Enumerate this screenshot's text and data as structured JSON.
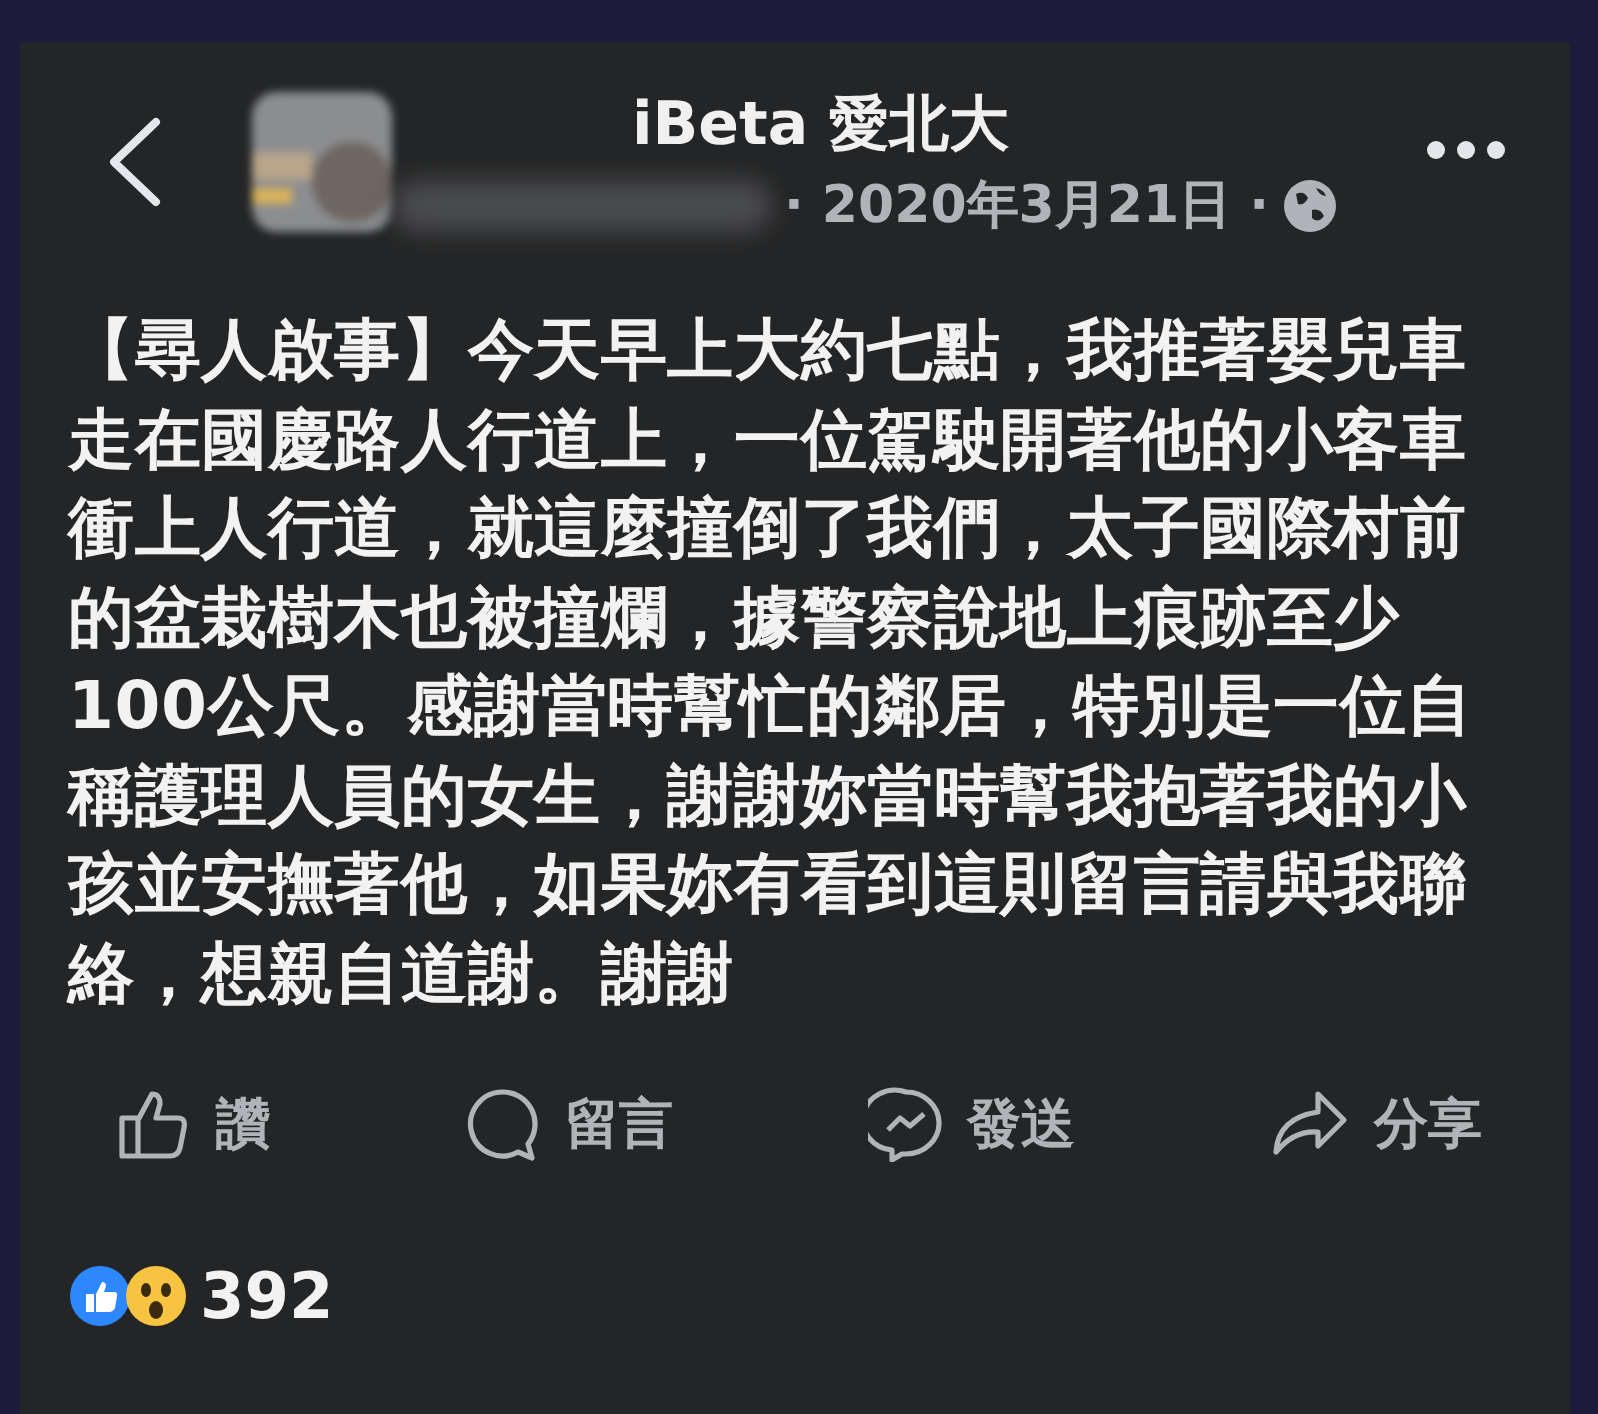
{
  "post": {
    "author": "iBeta 愛北大",
    "date": "· 2020年3月21日 ·",
    "text": "【尋人啟事】今天早上大約七點，我推著嬰兒車走在國慶路人行道上，一位駕駛開著他的小客車衝上人行道，就這麼撞倒了我們，太子國際村前的盆栽樹木也被撞爛，據警察說地上痕跡至少100公尺。感謝當時幫忙的鄰居，特別是一位自稱護理人員的女生，謝謝妳當時幫我抱著我的小孩並安撫著他，如果妳有看到這則留言請與我聯絡，想親自道謝。謝謝"
  },
  "actions": [
    {
      "kind": "like",
      "label": "讚"
    },
    {
      "kind": "comment",
      "label": "留言"
    },
    {
      "kind": "send",
      "label": "發送"
    },
    {
      "kind": "share",
      "label": "分享"
    }
  ],
  "reactions": {
    "count": "392"
  }
}
